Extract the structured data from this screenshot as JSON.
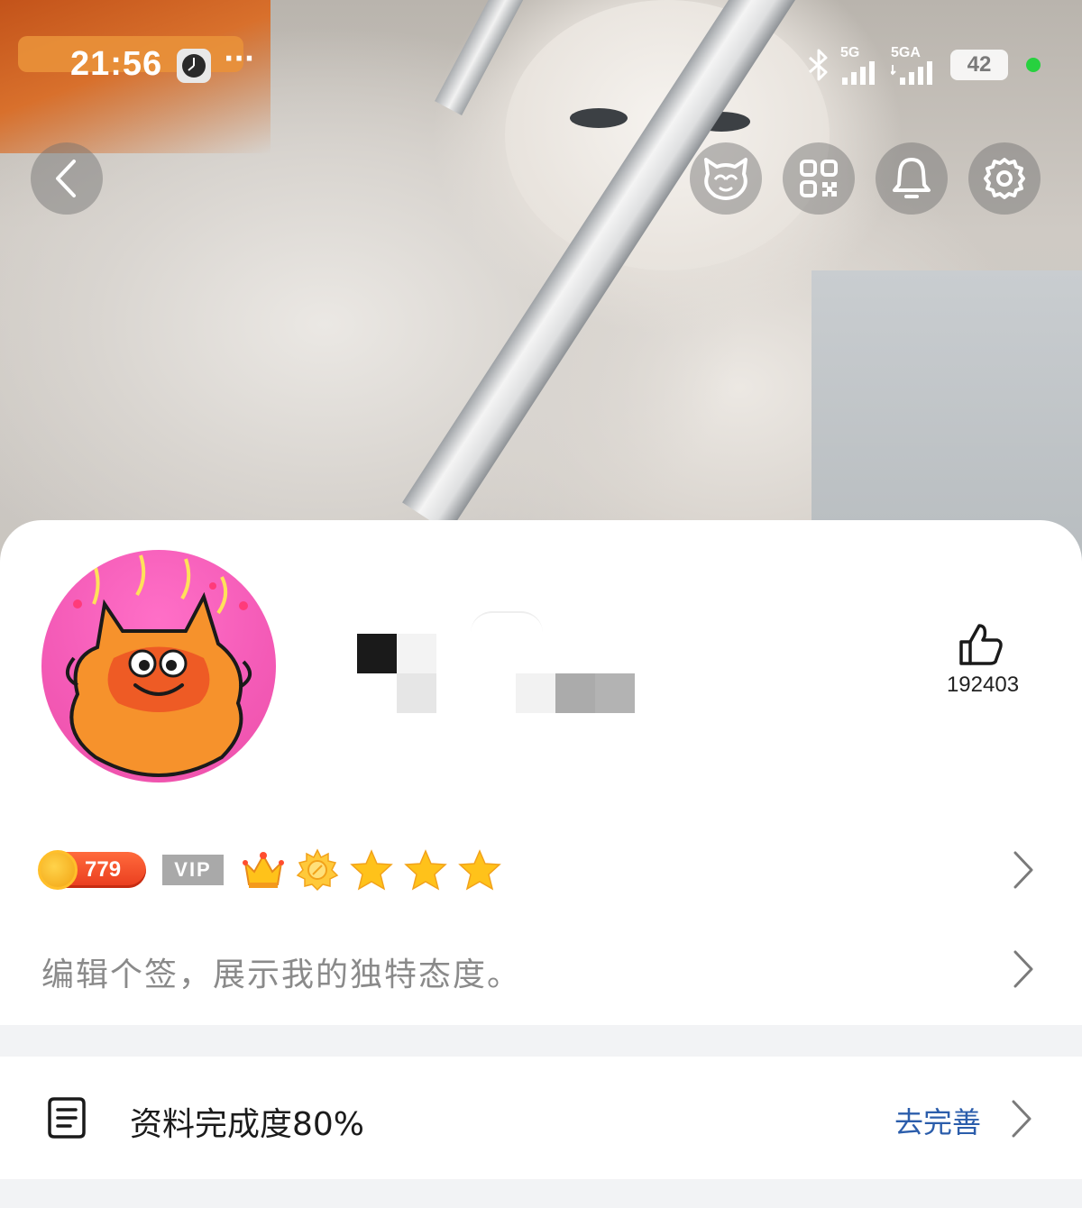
{
  "status_bar": {
    "time": "21:56",
    "more": "···",
    "network_1": "5G",
    "network_2": "5GA",
    "battery": "42"
  },
  "top_actions": {
    "back_icon": "chevron-left-icon",
    "mascot_icon": "cat-face-icon",
    "qr_icon": "qr-code-icon",
    "bell_icon": "bell-icon",
    "settings_icon": "gear-icon"
  },
  "profile": {
    "like_count": "192403",
    "coin_level": "779",
    "vip_label": "VIP",
    "level_icons": [
      "crown-icon",
      "sun-icon",
      "star-icon",
      "star-icon",
      "star-icon"
    ]
  },
  "signature": {
    "placeholder": "编辑个签，展示我的独特态度。"
  },
  "profile_completion": {
    "label": "资料完成度80%",
    "action": "去完善",
    "percent": 80
  },
  "colors": {
    "link": "#2b5dab",
    "coin_badge": "#e93c1e",
    "vip_badge": "#a9a9a9"
  }
}
